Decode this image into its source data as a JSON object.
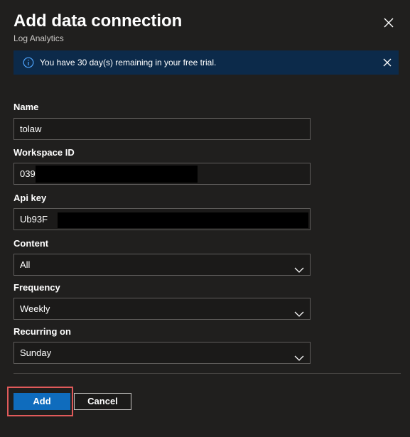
{
  "dialog": {
    "title": "Add data connection",
    "subtitle": "Log Analytics"
  },
  "banner": {
    "text": "You have 30 day(s) remaining in your free trial.",
    "bg_color": "#0c2a4a"
  },
  "form": {
    "name_label": "Name",
    "name_value": "tolaw",
    "workspace_label": "Workspace ID",
    "workspace_value": "039",
    "apikey_label": "Api key",
    "apikey_value": "Ub93F",
    "content_label": "Content",
    "content_value": "All",
    "frequency_label": "Frequency",
    "frequency_value": "Weekly",
    "recurring_label": "Recurring on",
    "recurring_value": "Sunday"
  },
  "actions": {
    "add_label": "Add",
    "cancel_label": "Cancel",
    "accent_color": "#0f6cbd",
    "highlight_color": "#e05a5a"
  }
}
